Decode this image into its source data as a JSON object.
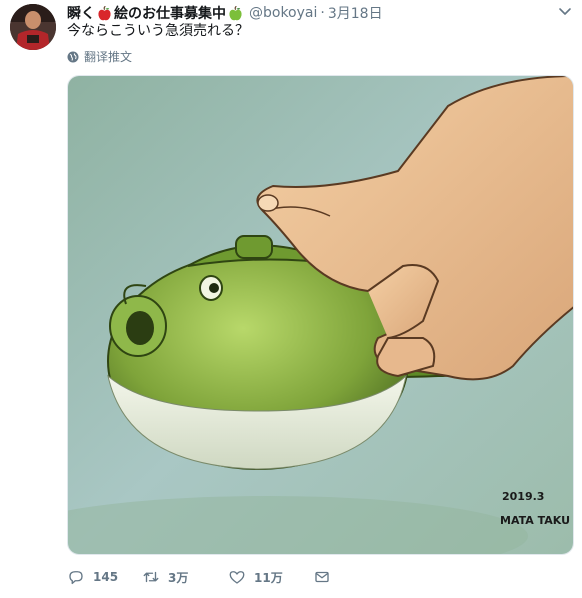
{
  "user": {
    "name_part1": "瞬く",
    "name_part2": "絵のお仕事募集中",
    "handle": "@bokoyai",
    "separator": "·",
    "date": "3月18日"
  },
  "tweet": {
    "text": "今ならこういう急須売れる？",
    "translate_label": "翻译推文"
  },
  "image": {
    "signature_date": "2019.3",
    "signature_name": "MATA TAKU"
  },
  "actions": {
    "reply_count": "145",
    "retweet_count": "3万",
    "like_count": "11万"
  },
  "icons": {
    "emoji_1": "red-apple-icon",
    "emoji_2": "green-apple-icon",
    "menu": "chevron-down-icon",
    "translate": "globe-icon",
    "reply": "reply-icon",
    "retweet": "retweet-icon",
    "like": "heart-icon",
    "dm": "envelope-icon"
  },
  "colors": {
    "secondary_text": "#657786",
    "primary_text": "#14171a",
    "border": "#e1e8ed"
  }
}
